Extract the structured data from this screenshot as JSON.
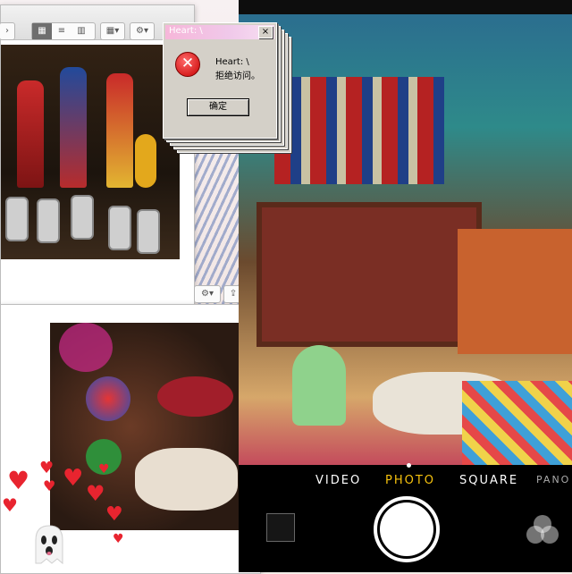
{
  "dialog": {
    "title": "Heart: \\",
    "close_glyph": "×",
    "message_line1": "Heart: \\",
    "message_line2": "拒绝访问。",
    "ok_label": "确定",
    "icon": "error-x-icon"
  },
  "camera": {
    "modes": [
      {
        "label": "VIDEO"
      },
      {
        "label": "PHOTO"
      },
      {
        "label": "SQUARE"
      },
      {
        "label": "PANO"
      }
    ],
    "active_mode": "PHOTO",
    "accent_color": "#f6c20e"
  },
  "finder": {
    "back_glyph": "›",
    "view_icons": [
      "icon-view-icon",
      "list-view-icon",
      "column-view-icon"
    ],
    "gear_glyph": "⚙",
    "share_glyph": "⇪"
  },
  "stickers": [
    "heart-icon",
    "ghost-icon"
  ]
}
